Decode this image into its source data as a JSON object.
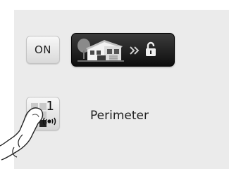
{
  "controls": {
    "on_button_label": "ON",
    "scenario_icons": [
      "house-icon",
      "double-chevron-right-icon",
      "unlocked-padlock-icon"
    ]
  },
  "zone": {
    "number": "1",
    "label": "Perimeter",
    "icons": [
      "zone-grid-icon",
      "siren-icon"
    ]
  },
  "hint": {
    "icon": "pointing-finger-icon"
  },
  "colors": {
    "panel_background": "#ebebeb",
    "scenario_button_background": "#111111",
    "on_button_background": "#e8e8e8",
    "text": "#222222"
  }
}
